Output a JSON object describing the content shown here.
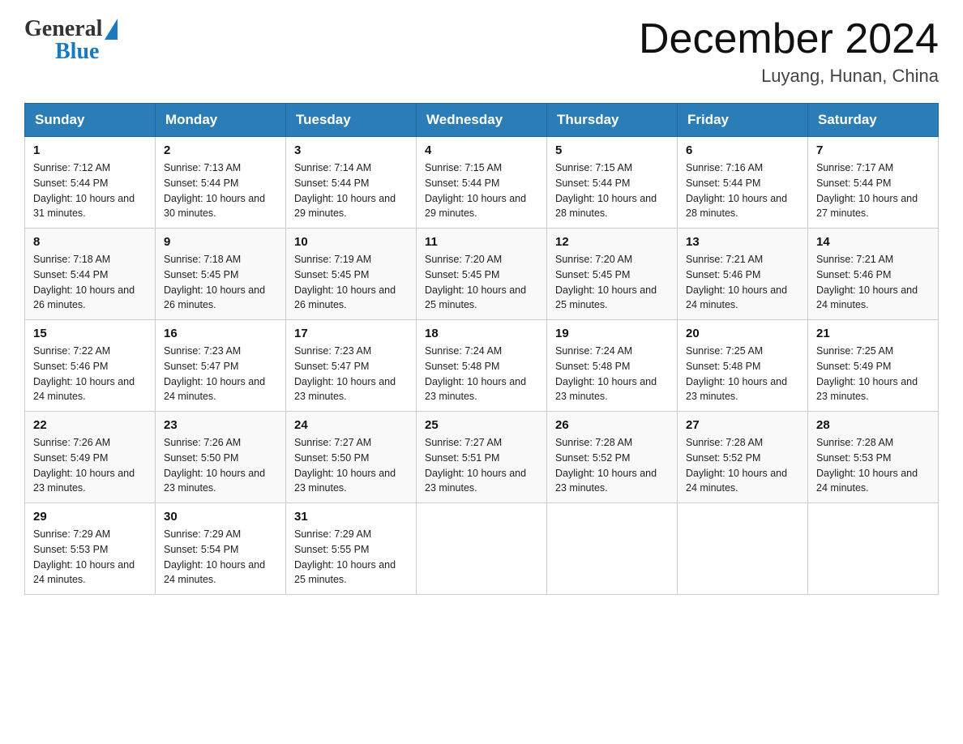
{
  "header": {
    "logo_general": "General",
    "logo_blue": "Blue",
    "title": "December 2024",
    "location": "Luyang, Hunan, China"
  },
  "weekdays": [
    "Sunday",
    "Monday",
    "Tuesday",
    "Wednesday",
    "Thursday",
    "Friday",
    "Saturday"
  ],
  "weeks": [
    [
      {
        "day": "1",
        "sunrise": "7:12 AM",
        "sunset": "5:44 PM",
        "daylight": "10 hours and 31 minutes."
      },
      {
        "day": "2",
        "sunrise": "7:13 AM",
        "sunset": "5:44 PM",
        "daylight": "10 hours and 30 minutes."
      },
      {
        "day": "3",
        "sunrise": "7:14 AM",
        "sunset": "5:44 PM",
        "daylight": "10 hours and 29 minutes."
      },
      {
        "day": "4",
        "sunrise": "7:15 AM",
        "sunset": "5:44 PM",
        "daylight": "10 hours and 29 minutes."
      },
      {
        "day": "5",
        "sunrise": "7:15 AM",
        "sunset": "5:44 PM",
        "daylight": "10 hours and 28 minutes."
      },
      {
        "day": "6",
        "sunrise": "7:16 AM",
        "sunset": "5:44 PM",
        "daylight": "10 hours and 28 minutes."
      },
      {
        "day": "7",
        "sunrise": "7:17 AM",
        "sunset": "5:44 PM",
        "daylight": "10 hours and 27 minutes."
      }
    ],
    [
      {
        "day": "8",
        "sunrise": "7:18 AM",
        "sunset": "5:44 PM",
        "daylight": "10 hours and 26 minutes."
      },
      {
        "day": "9",
        "sunrise": "7:18 AM",
        "sunset": "5:45 PM",
        "daylight": "10 hours and 26 minutes."
      },
      {
        "day": "10",
        "sunrise": "7:19 AM",
        "sunset": "5:45 PM",
        "daylight": "10 hours and 26 minutes."
      },
      {
        "day": "11",
        "sunrise": "7:20 AM",
        "sunset": "5:45 PM",
        "daylight": "10 hours and 25 minutes."
      },
      {
        "day": "12",
        "sunrise": "7:20 AM",
        "sunset": "5:45 PM",
        "daylight": "10 hours and 25 minutes."
      },
      {
        "day": "13",
        "sunrise": "7:21 AM",
        "sunset": "5:46 PM",
        "daylight": "10 hours and 24 minutes."
      },
      {
        "day": "14",
        "sunrise": "7:21 AM",
        "sunset": "5:46 PM",
        "daylight": "10 hours and 24 minutes."
      }
    ],
    [
      {
        "day": "15",
        "sunrise": "7:22 AM",
        "sunset": "5:46 PM",
        "daylight": "10 hours and 24 minutes."
      },
      {
        "day": "16",
        "sunrise": "7:23 AM",
        "sunset": "5:47 PM",
        "daylight": "10 hours and 24 minutes."
      },
      {
        "day": "17",
        "sunrise": "7:23 AM",
        "sunset": "5:47 PM",
        "daylight": "10 hours and 23 minutes."
      },
      {
        "day": "18",
        "sunrise": "7:24 AM",
        "sunset": "5:48 PM",
        "daylight": "10 hours and 23 minutes."
      },
      {
        "day": "19",
        "sunrise": "7:24 AM",
        "sunset": "5:48 PM",
        "daylight": "10 hours and 23 minutes."
      },
      {
        "day": "20",
        "sunrise": "7:25 AM",
        "sunset": "5:48 PM",
        "daylight": "10 hours and 23 minutes."
      },
      {
        "day": "21",
        "sunrise": "7:25 AM",
        "sunset": "5:49 PM",
        "daylight": "10 hours and 23 minutes."
      }
    ],
    [
      {
        "day": "22",
        "sunrise": "7:26 AM",
        "sunset": "5:49 PM",
        "daylight": "10 hours and 23 minutes."
      },
      {
        "day": "23",
        "sunrise": "7:26 AM",
        "sunset": "5:50 PM",
        "daylight": "10 hours and 23 minutes."
      },
      {
        "day": "24",
        "sunrise": "7:27 AM",
        "sunset": "5:50 PM",
        "daylight": "10 hours and 23 minutes."
      },
      {
        "day": "25",
        "sunrise": "7:27 AM",
        "sunset": "5:51 PM",
        "daylight": "10 hours and 23 minutes."
      },
      {
        "day": "26",
        "sunrise": "7:28 AM",
        "sunset": "5:52 PM",
        "daylight": "10 hours and 23 minutes."
      },
      {
        "day": "27",
        "sunrise": "7:28 AM",
        "sunset": "5:52 PM",
        "daylight": "10 hours and 24 minutes."
      },
      {
        "day": "28",
        "sunrise": "7:28 AM",
        "sunset": "5:53 PM",
        "daylight": "10 hours and 24 minutes."
      }
    ],
    [
      {
        "day": "29",
        "sunrise": "7:29 AM",
        "sunset": "5:53 PM",
        "daylight": "10 hours and 24 minutes."
      },
      {
        "day": "30",
        "sunrise": "7:29 AM",
        "sunset": "5:54 PM",
        "daylight": "10 hours and 24 minutes."
      },
      {
        "day": "31",
        "sunrise": "7:29 AM",
        "sunset": "5:55 PM",
        "daylight": "10 hours and 25 minutes."
      },
      null,
      null,
      null,
      null
    ]
  ]
}
